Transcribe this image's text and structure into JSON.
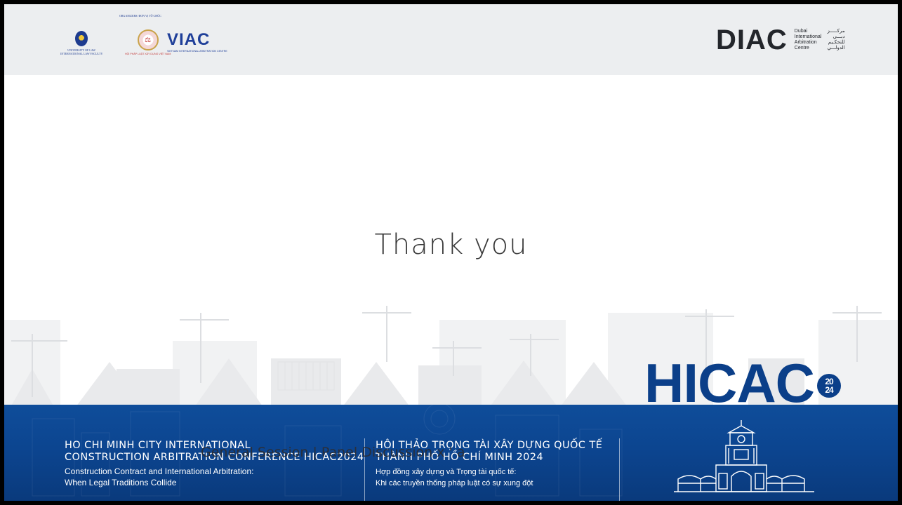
{
  "header": {
    "university_logo": {
      "line1": "UNIVERSITY OF LAW",
      "line2": "INTERNATIONAL LAW FACULTY"
    },
    "organizers_label": "ORGANIZERS/ ĐƠN VỊ TỔ CHỨC",
    "hoi_logo_caption": "HỘI PHÁP LUẬT XÂY DỰNG VIỆT NAM",
    "viac_logo": {
      "word": "VIAC",
      "caption": "VIETNAM INTERNATIONAL ARBITRATION CENTRE"
    },
    "diac_logo": {
      "mark": "DIAC",
      "en": [
        "Dubai",
        "International",
        "Arbitration",
        "Centre"
      ],
      "ar": [
        "مركـــــز",
        "دبـــي",
        "للتحكـيم",
        "الدولـــي"
      ]
    }
  },
  "main": {
    "title": "Thank you"
  },
  "hicac": {
    "word": "HICAC",
    "year_top": "20",
    "year_bottom": "24"
  },
  "footer": {
    "en_title_1": "HO CHI MINH CITY INTERNATIONAL",
    "en_title_2": "CONSTRUCTION ARBITRATION CONFERENCE HICAC2024",
    "en_sub_1": "Construction Contract and International Arbitration:",
    "en_sub_2": "When Legal Traditions Collide",
    "vi_title_1": "HỘI THẢO TRỌNG TÀI XÂY DỰNG QUỐC TẾ",
    "vi_title_2": "THÀNH PHỐ HỒ CHÍ MINH 2024",
    "vi_sub_1": "Hợp đồng xây dựng và Trọng tài quốc tế:",
    "vi_sub_2": "Khi các truyền thống pháp luật có sự xung đột"
  },
  "caption": "General Session | Panel Discussion x ' a"
}
